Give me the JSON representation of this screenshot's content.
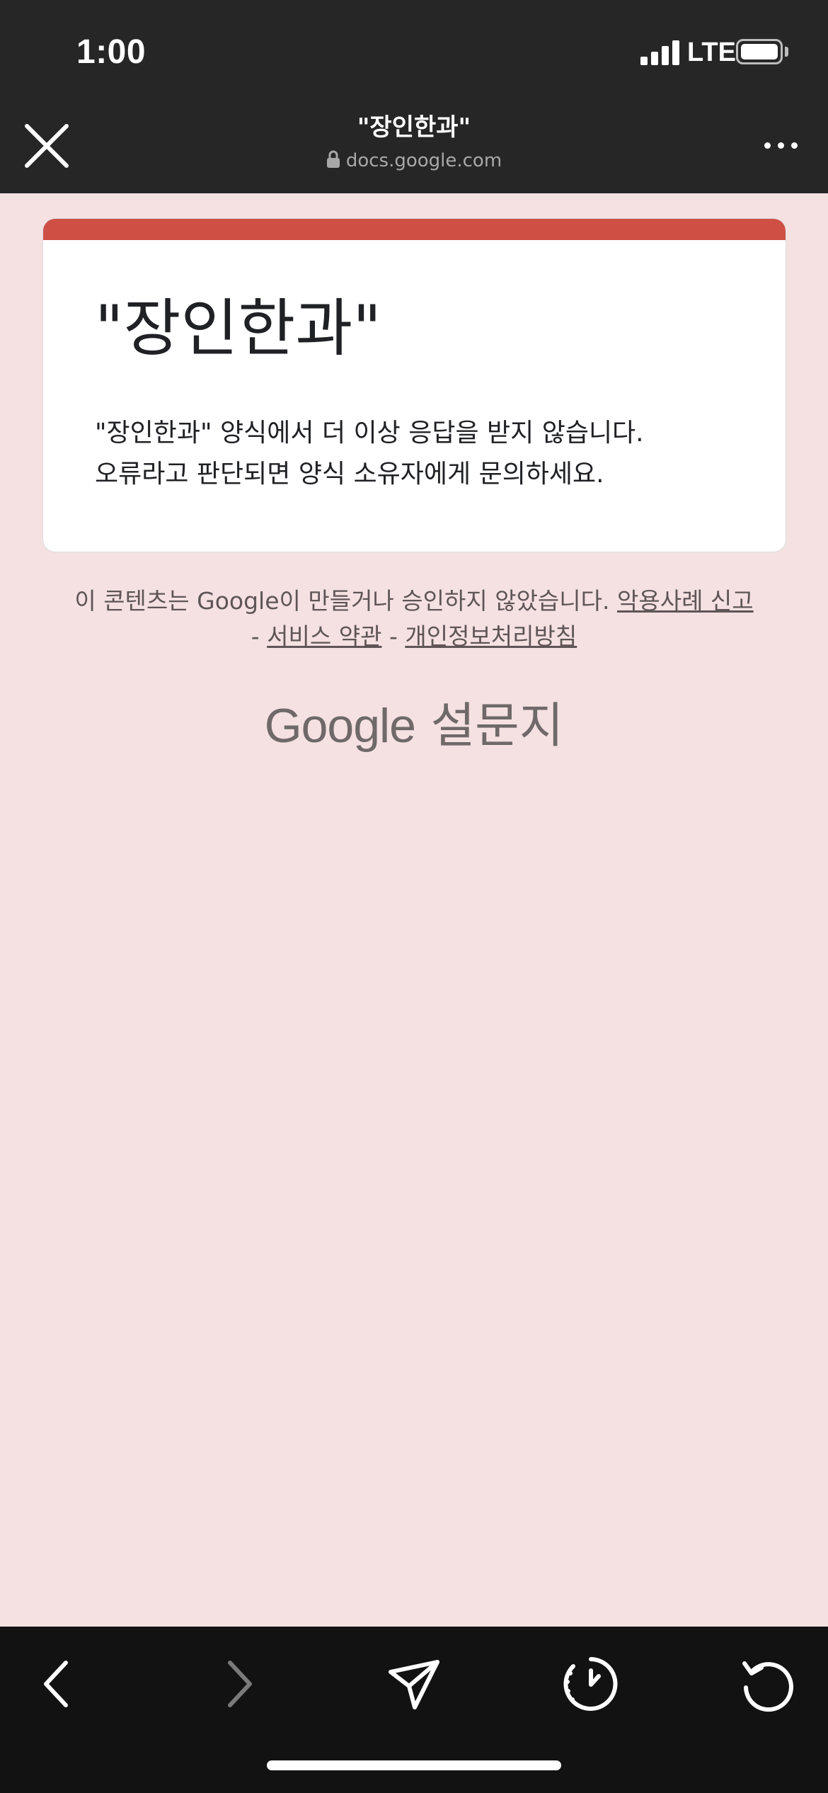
{
  "status_bar": {
    "time": "1:00",
    "network": "LTE"
  },
  "header": {
    "title": "\"장인한과\"",
    "url": "docs.google.com",
    "close_icon": "close-icon",
    "more_icon": "more-horizontal-icon"
  },
  "card": {
    "accent_color": "#cf4f44",
    "title": "\"장인한과\"",
    "message_line1": "\"장인한과\" 양식에서 더 이상 응답을 받지 않습니다.",
    "message_line2": "오류라고 판단되면 양식 소유자에게 문의하세요."
  },
  "footer": {
    "disclaimer": "이 콘텐츠는 Google이 만들거나 승인하지 않았습니다. ",
    "report_link": "악용사례 신고",
    "separator": " - ",
    "terms_link": "서비스 약관",
    "privacy_link": "개인정보처리방침"
  },
  "brand": {
    "google": "Google",
    "product": "설문지"
  },
  "toolbar": {
    "items": [
      "back-icon",
      "forward-icon",
      "share-icon",
      "history-icon",
      "reload-icon"
    ]
  },
  "colors": {
    "page_background": "#f5e1e1",
    "top_bar": "#262626",
    "bottom_bar": "#121212"
  }
}
